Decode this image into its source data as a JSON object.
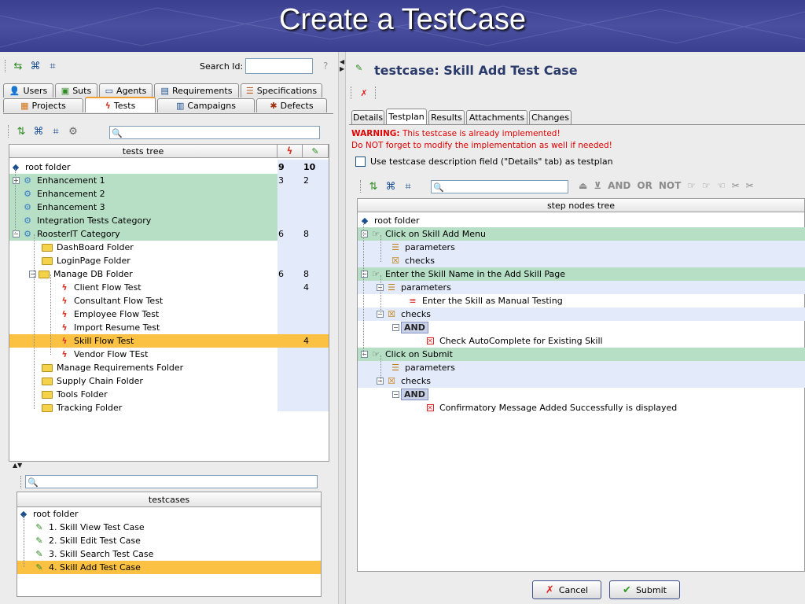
{
  "slide": {
    "title": "Create a TestCase"
  },
  "left": {
    "search_id_label": "Search Id:",
    "search_id_value": "",
    "help": "?",
    "tabs_row1": [
      {
        "label": "Users",
        "icon": "users-icon"
      },
      {
        "label": "Suts",
        "icon": "suts-icon"
      },
      {
        "label": "Agents",
        "icon": "agents-icon"
      },
      {
        "label": "Requirements",
        "icon": "requirements-icon"
      },
      {
        "label": "Specifications",
        "icon": "specifications-icon"
      }
    ],
    "tabs_row2": [
      {
        "label": "Projects",
        "icon": "projects-icon"
      },
      {
        "label": "Tests",
        "icon": "tests-icon",
        "active": true
      },
      {
        "label": "Campaigns",
        "icon": "campaigns-icon"
      },
      {
        "label": "Defects",
        "icon": "defects-icon"
      }
    ],
    "tests_tree": {
      "header": "tests tree",
      "rows": [
        {
          "label": "root folder",
          "a": "9",
          "b": "10"
        },
        {
          "label": "Enhancement 1",
          "a": "3",
          "b": "2"
        },
        {
          "label": "Enhancement 2",
          "a": "",
          "b": ""
        },
        {
          "label": "Enhancement 3",
          "a": "",
          "b": ""
        },
        {
          "label": "Integration Tests Category",
          "a": "",
          "b": ""
        },
        {
          "label": "RoosterIT Category",
          "a": "6",
          "b": "8"
        },
        {
          "label": "DashBoard Folder",
          "a": "",
          "b": ""
        },
        {
          "label": "LoginPage Folder",
          "a": "",
          "b": ""
        },
        {
          "label": "Manage DB Folder",
          "a": "6",
          "b": "8"
        },
        {
          "label": "Client Flow Test",
          "a": "",
          "b": "4"
        },
        {
          "label": "Consultant Flow Test",
          "a": "",
          "b": ""
        },
        {
          "label": "Employee Flow Test",
          "a": "",
          "b": ""
        },
        {
          "label": "Import Resume Test",
          "a": "",
          "b": ""
        },
        {
          "label": "Skill Flow Test",
          "a": "",
          "b": "4"
        },
        {
          "label": "Vendor Flow TEst",
          "a": "",
          "b": ""
        },
        {
          "label": "Manage Requirements Folder",
          "a": "",
          "b": ""
        },
        {
          "label": "Supply Chain Folder",
          "a": "",
          "b": ""
        },
        {
          "label": "Tools Folder",
          "a": "",
          "b": ""
        },
        {
          "label": "Tracking Folder",
          "a": "",
          "b": ""
        }
      ]
    },
    "testcases": {
      "header": "testcases",
      "rows": [
        {
          "label": "root folder"
        },
        {
          "label": "1. Skill View Test Case"
        },
        {
          "label": "2. Skill Edit Test Case"
        },
        {
          "label": "3. Skill Search Test Case"
        },
        {
          "label": "4. Skill Add Test Case"
        }
      ]
    }
  },
  "right": {
    "title": "testcase: Skill Add Test Case",
    "tabs": [
      "Details",
      "Testplan",
      "Results",
      "Attachments",
      "Changes"
    ],
    "warning_prefix": "WARNING:",
    "warning_text": " This testcase is already implemented!",
    "warning_line2": "Do NOT forget to modify the implementation as well if needed!",
    "use_desc_label": "Use testcase description field (\"Details\" tab) as testplan",
    "ops": [
      "AND",
      "OR",
      "NOT"
    ],
    "step_tree": {
      "header": "step nodes tree",
      "rows": [
        {
          "label": "root folder"
        },
        {
          "label": "Click on Skill Add Menu"
        },
        {
          "label": "parameters"
        },
        {
          "label": "checks"
        },
        {
          "label": "Enter the Skill Name in the Add Skill Page"
        },
        {
          "label": "parameters"
        },
        {
          "label": "Enter the Skill as Manual Testing"
        },
        {
          "label": "checks"
        },
        {
          "label": "AND"
        },
        {
          "label": "Check AutoComplete for Existing Skill"
        },
        {
          "label": "Click on Submit"
        },
        {
          "label": "parameters"
        },
        {
          "label": "checks"
        },
        {
          "label": "AND"
        },
        {
          "label": "Confirmatory Message Added Successfully is displayed"
        }
      ]
    },
    "cancel_label": "Cancel",
    "submit_label": "Submit"
  }
}
